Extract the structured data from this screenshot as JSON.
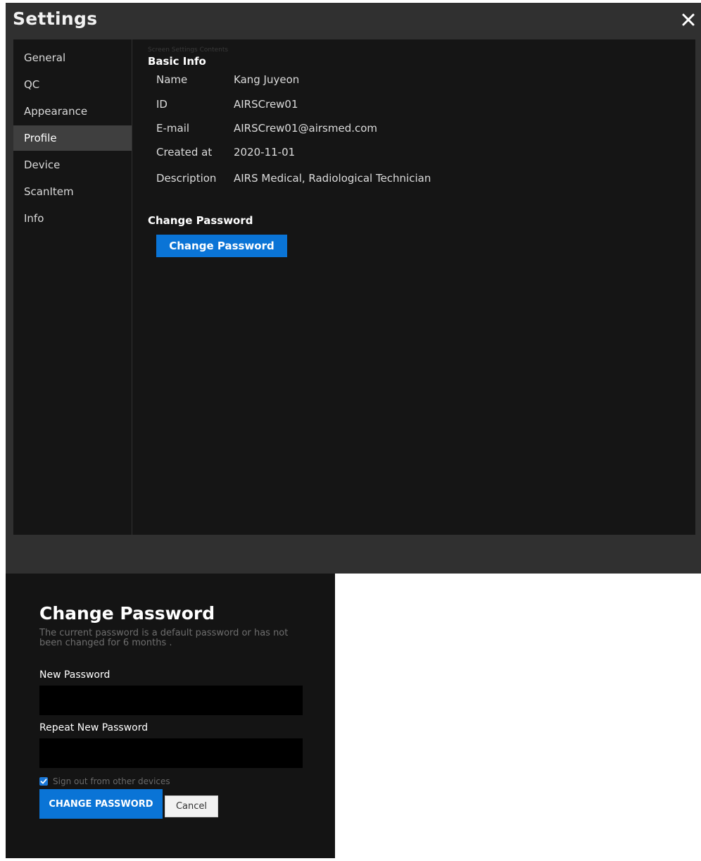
{
  "settings": {
    "title": "Settings",
    "sidebar": {
      "items": [
        {
          "label": "General"
        },
        {
          "label": "QC"
        },
        {
          "label": "Appearance"
        },
        {
          "label": "Profile"
        },
        {
          "label": "Device"
        },
        {
          "label": "ScanItem"
        },
        {
          "label": "Info"
        }
      ],
      "active": "Profile"
    },
    "content": {
      "ghost_label": "Screen Settings Contents",
      "basic_info_title": "Basic Info",
      "fields": [
        {
          "label": "Name",
          "value": "Kang Juyeon"
        },
        {
          "label": "ID",
          "value": "AIRSCrew01"
        },
        {
          "label": "E-mail",
          "value": "AIRSCrew01@airsmed.com"
        },
        {
          "label": "Created at",
          "value": "2020-11-01"
        },
        {
          "label": "Description",
          "value": "AIRS Medical, Radiological Technician"
        }
      ],
      "change_password_title": "Change Password",
      "change_password_button": "Change Password"
    }
  },
  "dialog": {
    "title": "Change Password",
    "subtitle": "The current password is a default password or has not been changed for 6 months .",
    "new_password_label": "New Password",
    "new_password_value": "",
    "repeat_password_label": "Repeat New Password",
    "repeat_password_value": "",
    "sign_out_label": "Sign out from other devices",
    "sign_out_checked": true,
    "submit_label": "CHANGE PASSWORD",
    "cancel_label": "Cancel"
  },
  "colors": {
    "accent": "#0a74d6",
    "panel": "#151515",
    "window": "#303030"
  }
}
